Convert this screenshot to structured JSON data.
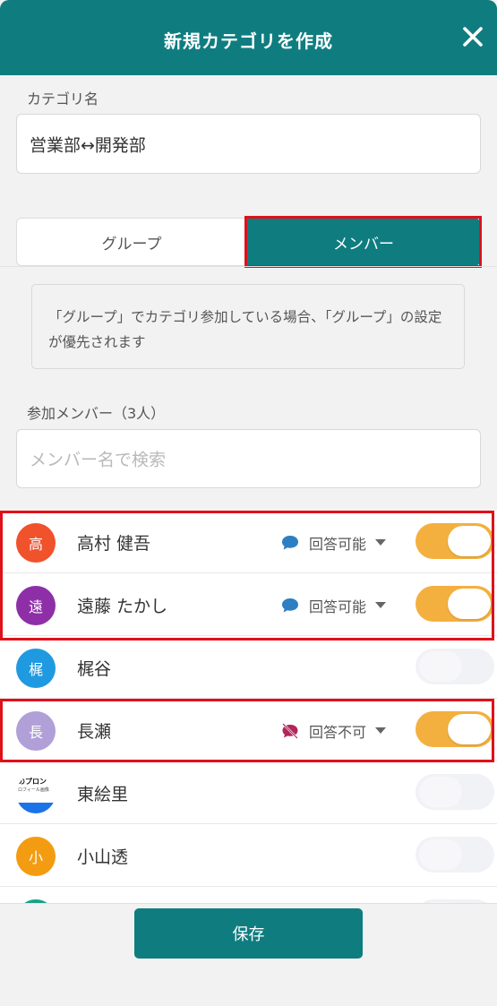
{
  "header": {
    "title": "新規カテゴリを作成",
    "accent": "#0f7d80"
  },
  "category": {
    "label": "カテゴリ名",
    "value": "営業部↔開発部"
  },
  "tabs": [
    {
      "label": "グループ",
      "selected": false
    },
    {
      "label": "メンバー",
      "selected": true
    }
  ],
  "note": {
    "text": "「グループ」でカテゴリ参加している場合、「グループ」の設定が優先されます"
  },
  "members": {
    "label": "参加メンバー（3人）",
    "search_placeholder": "メンバー名で検索",
    "items": [
      {
        "avatar": "高",
        "avatar_color": "#f0522c",
        "name": "高村 健吾",
        "permission": "回答可能",
        "permission_icon": "chat-bubble-icon",
        "enabled": true
      },
      {
        "avatar": "遠",
        "avatar_color": "#8e2fa8",
        "name": "遠藤 たかし",
        "permission": "回答可能",
        "permission_icon": "chat-bubble-icon",
        "enabled": true
      },
      {
        "avatar": "梶",
        "avatar_color": "#1f9ae0",
        "name": "梶谷",
        "permission": "",
        "enabled": false
      },
      {
        "avatar": "長",
        "avatar_color": "#b19fd8",
        "name": "長瀬",
        "permission": "回答不可",
        "permission_icon": "chat-disabled-icon",
        "enabled": true
      },
      {
        "avatar": "",
        "avatar_image_text": "のプロン",
        "avatar_image_subtext": "ロフィール画像",
        "avatar_color": "#ffffff",
        "name": "東絵里",
        "permission": "",
        "enabled": false
      },
      {
        "avatar": "小",
        "avatar_color": "#f39c12",
        "name": "小山透",
        "permission": "",
        "enabled": false
      }
    ]
  },
  "footer": {
    "save_label": "保存"
  }
}
